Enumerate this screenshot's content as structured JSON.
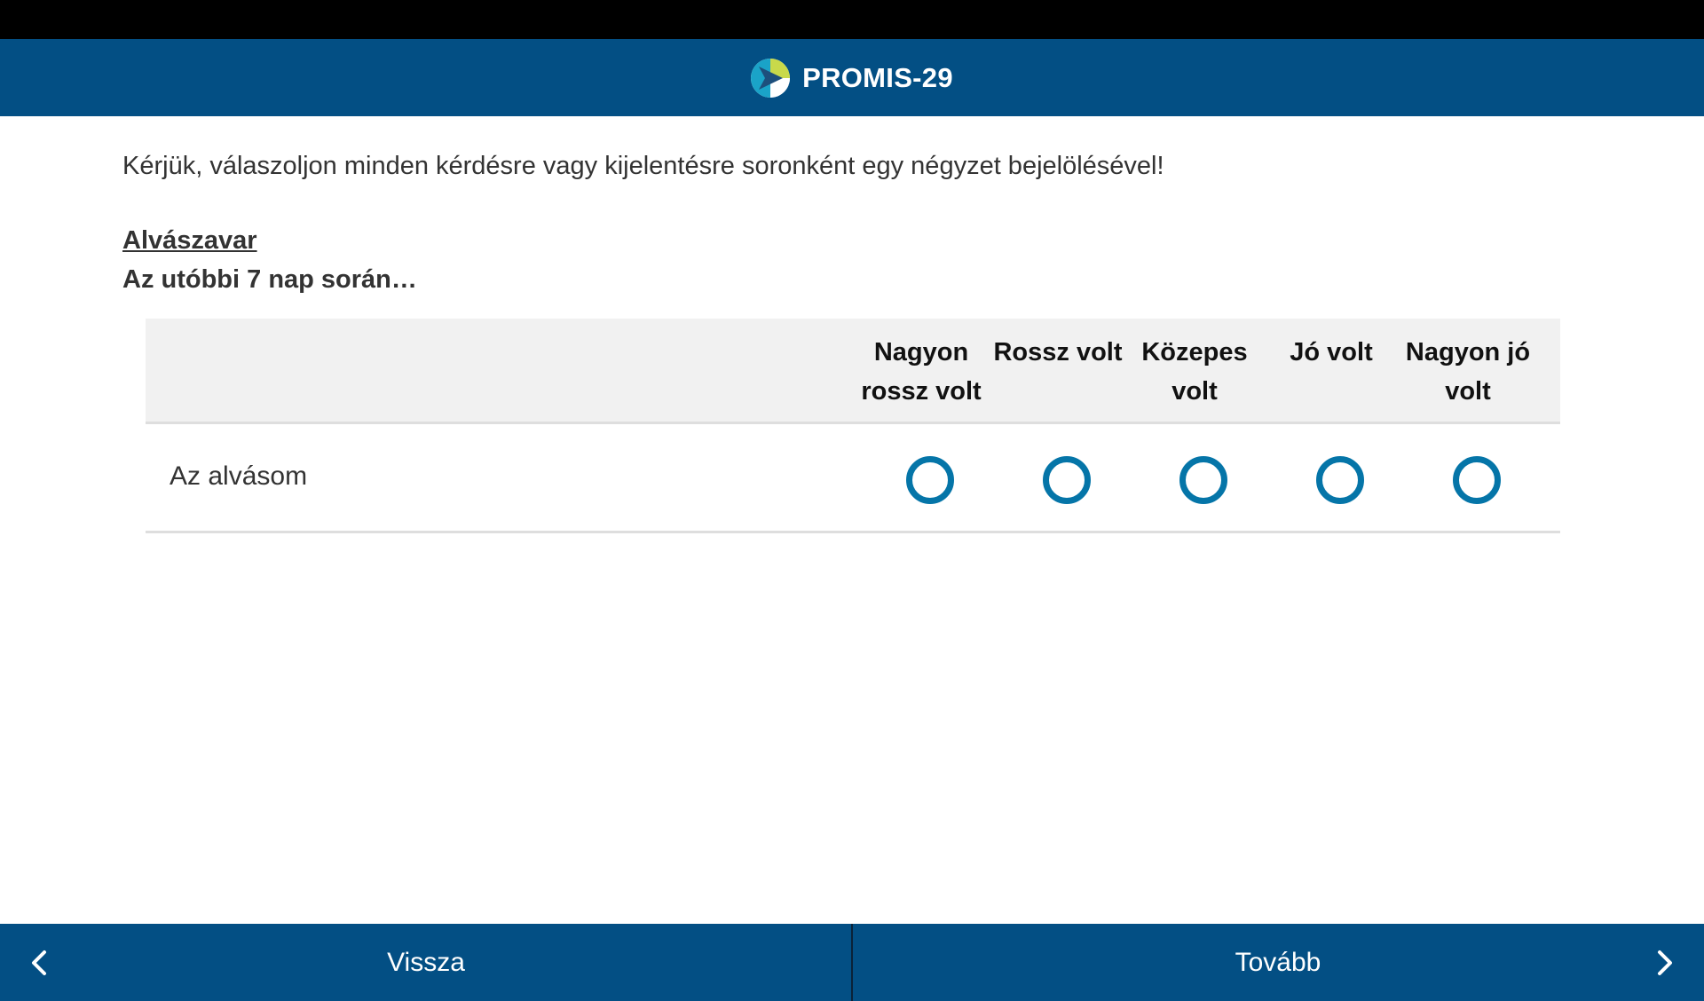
{
  "header": {
    "title": "PROMIS-29",
    "logo_icon": "promis-logo-icon",
    "background": "#034f84"
  },
  "main": {
    "instruction": "Kérjük, válaszoljon minden kérdésre vagy kijelentésre soronként egy négyzet bejelölésével!",
    "section_title": "Alvászavar",
    "timeframe": "Az utóbbi 7 nap során…",
    "table": {
      "columns": [
        {
          "label": "Nagyon rossz volt"
        },
        {
          "label": "Rossz volt"
        },
        {
          "label": "Közepes volt"
        },
        {
          "label": "Jó volt"
        },
        {
          "label": "Nagyon jó volt"
        }
      ],
      "rows": [
        {
          "label": "Az alvásom",
          "selected": null
        }
      ],
      "radio_color": "#0575a8"
    }
  },
  "footer": {
    "back_label": "Vissza",
    "next_label": "Tovább",
    "back_icon": "chevron-left-icon",
    "next_icon": "chevron-right-icon"
  }
}
